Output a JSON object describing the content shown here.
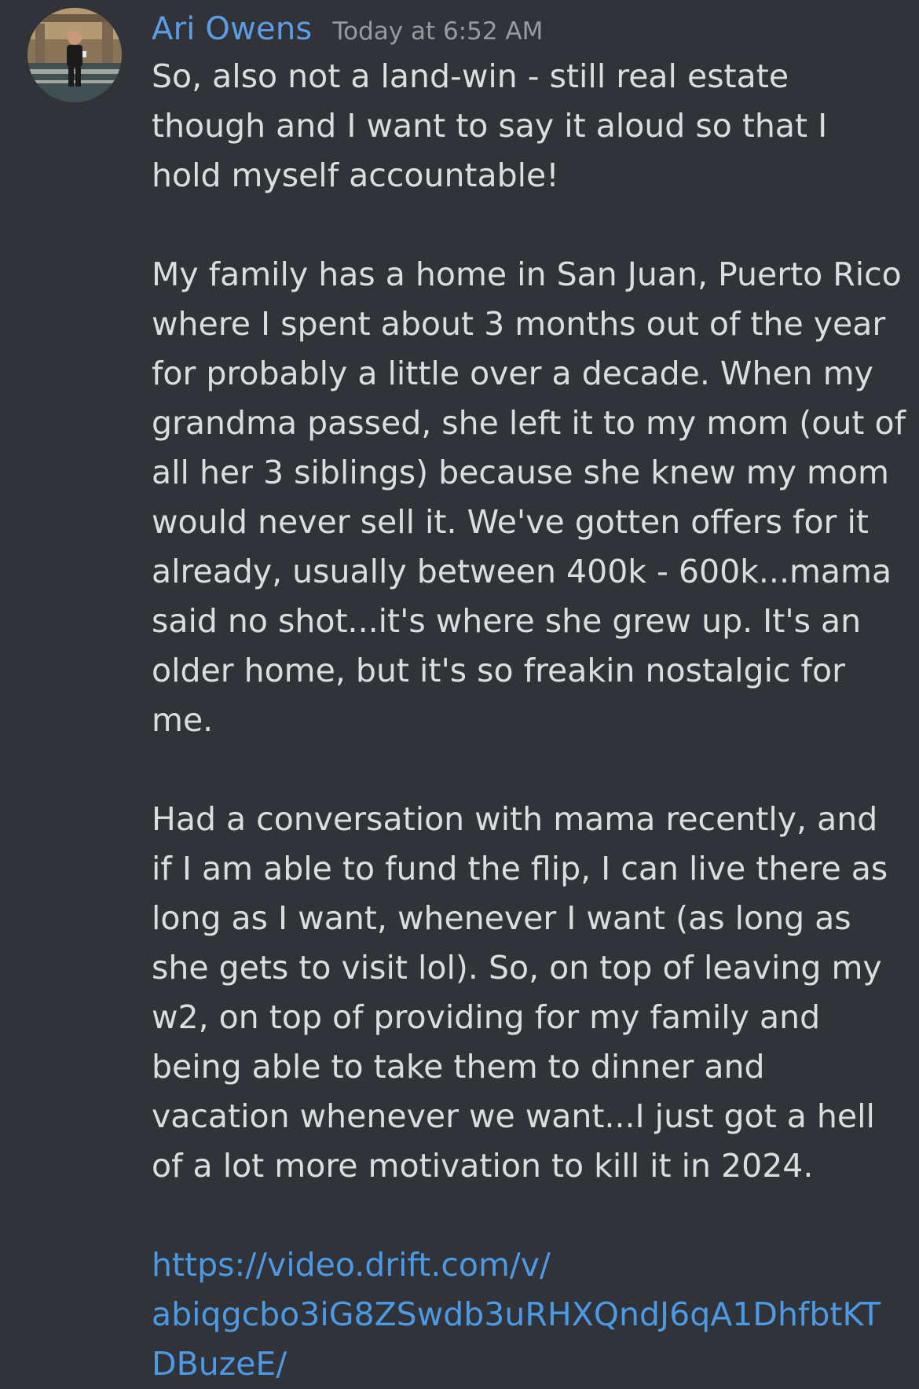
{
  "message": {
    "author": "Ari Owens",
    "timestamp": "Today at 6:52 AM",
    "paragraphs": [
      "So, also not a land-win - still real estate though and I want to say it aloud so that I hold myself accountable!",
      "My family has a home in San Juan, Puerto Rico where I spent about 3 months out of the year for probably a little over a decade. When my grandma passed, she left it to my mom (out of all her 3 siblings) because she knew my mom would never sell it. We've gotten offers for it already, usually between 400k - 600k...mama said no shot...it's where she grew up. It's an older home, but it's so freakin nostalgic for me.",
      "Had a conversation with mama recently, and if I am able to fund the flip, I can live there as long as I want, whenever I want (as long as she gets to visit lol). So, on top of leaving my w2, on top of providing for my family and being able to take them to dinner and vacation whenever we want...I just got a hell of a lot more motivation to kill it in 2024."
    ],
    "link_line1": "https://video.drift.com/v/",
    "link_line2": "abiqgcbo3iG8ZSwdb3uRHXQndJ6qA1DhfbtKT",
    "link_line3": "DBuzeE/"
  },
  "colors": {
    "background": "#313338",
    "username": "#5b9ee6",
    "timestamp": "#949ba4",
    "text": "#dbdee1",
    "link": "#4a9ae6"
  }
}
